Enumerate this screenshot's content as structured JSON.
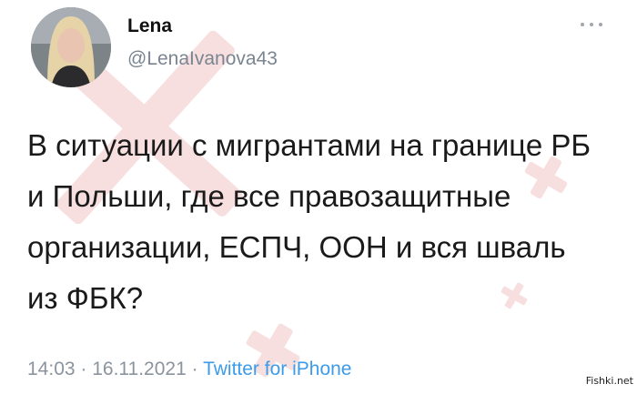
{
  "tweet": {
    "author_name": "Lena",
    "author_handle": "@LenaIvanova43",
    "text": "В ситуации с мигрантами на границе РБ и Польши, где все правозащитные организации, ЕСПЧ, ООН и вся шваль из ФБК?",
    "time": "14:03",
    "separator": " · ",
    "date": "16.11.2021",
    "source": "Twitter for iPhone"
  },
  "watermark": {
    "site": "Fishki.net"
  },
  "colors": {
    "handle_gray": "#7a8591",
    "link_blue": "#3d9be9",
    "watermark_red": "#e8a8a8"
  },
  "icons": {
    "more": "more-options-icon"
  }
}
